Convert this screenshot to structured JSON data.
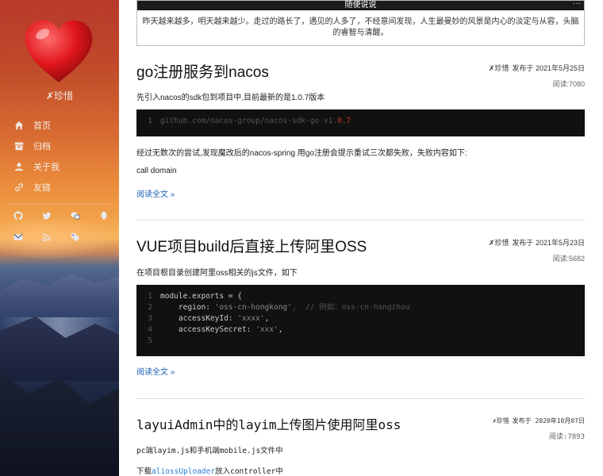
{
  "sidebar": {
    "site_name": "✗珍惜",
    "nav": [
      {
        "label": "首页",
        "icon": "home-icon"
      },
      {
        "label": "归档",
        "icon": "archive-icon"
      },
      {
        "label": "关于我",
        "icon": "user-icon"
      },
      {
        "label": "友链",
        "icon": "link-icon"
      }
    ],
    "social_row1": [
      "github-icon",
      "twitter-icon",
      "wechat-icon",
      "qq-icon"
    ],
    "social_row2": [
      "mail-icon",
      "rss-icon",
      "tag-icon"
    ]
  },
  "notice": {
    "title": "随便说说",
    "text": "昨天越来越多，明天越来越少。走过的路长了，遇见的人多了，不经意间发现，人生最曼妙的风景是内心的淡定与从容，头脑的睿智与清醒。"
  },
  "posts": [
    {
      "title": "go注册服务到nacos",
      "author": "✗珍惜",
      "published_prefix": "发布于",
      "date": "2021年5月25日",
      "views_label": "阅读:",
      "views": "7080",
      "intro": "先引入nacos的sdk包到项目中,目前最新的是1.0.7版本",
      "code": [
        {
          "n": "1",
          "text": "github.com/nacos-group/nacos-sdk-go v1.",
          "num": "0.7"
        }
      ],
      "para2": "经过无数次的尝试,发现魔改后的nacos-spring 用go注册会提示重试三次都失败，失败内容如下:",
      "para3": "call domain",
      "read_more": "阅读全文 »"
    },
    {
      "title": "VUE项目build后直接上传阿里OSS",
      "author": "✗珍惜",
      "published_prefix": "发布于",
      "date": "2021年5月23日",
      "views_label": "阅读:",
      "views": "5682",
      "intro": "在项目根目录创建阿里oss相关的js文件，如下",
      "code": [
        {
          "n": "1",
          "text": "module.exports = {"
        },
        {
          "n": "2",
          "key": "    region: ",
          "str": "'oss-cn-hongkong'",
          "comment": ",  // 例如：oss-cn-hangzhou"
        },
        {
          "n": "3",
          "key": "    accessKeyId: ",
          "str": "'xxxx'",
          "tail": ","
        },
        {
          "n": "4",
          "key": "    accessKeySecret: ",
          "str": "'xxx'",
          "tail": ","
        },
        {
          "n": "5",
          "text": ""
        }
      ],
      "read_more": "阅读全文 »"
    },
    {
      "title": "layuiAdmin中的layim上传图片使用阿里oss",
      "author": "✗珍惜",
      "published_prefix": "发布于",
      "date": "2020年10月07日",
      "views_label": "阅读:",
      "views": "7893",
      "para1": "pc端layim.js和手机端mobile.js文件中",
      "para2_prefix": "下载",
      "para2_code": "aliossUploader",
      "para2_mid": "放入",
      "para2_code2": "controller",
      "para2_suffix": "中"
    }
  ]
}
